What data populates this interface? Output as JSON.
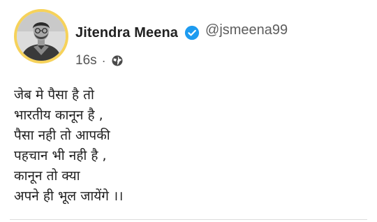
{
  "post": {
    "author": {
      "display_name": "Jitendra Meena",
      "handle": "@jsmeena99",
      "verified_icon": "verified-badge-icon",
      "avatar_ring_color": "#f6d25a"
    },
    "meta": {
      "timestamp": "16s",
      "separator": "·",
      "visibility_icon": "globe-icon"
    },
    "body_lines": [
      "जेब मे पैसा है तो",
      "भारतीय कानून है ,",
      "पैसा नही तो आपकी",
      "पहचान भी नही है ,",
      "कानून तो क्या",
      "अपने ही भूल जायेंगे ।।"
    ],
    "colors": {
      "verified_blue": "#1d9bf0",
      "name_text": "#222222",
      "secondary_text": "#5d5d5d"
    }
  }
}
